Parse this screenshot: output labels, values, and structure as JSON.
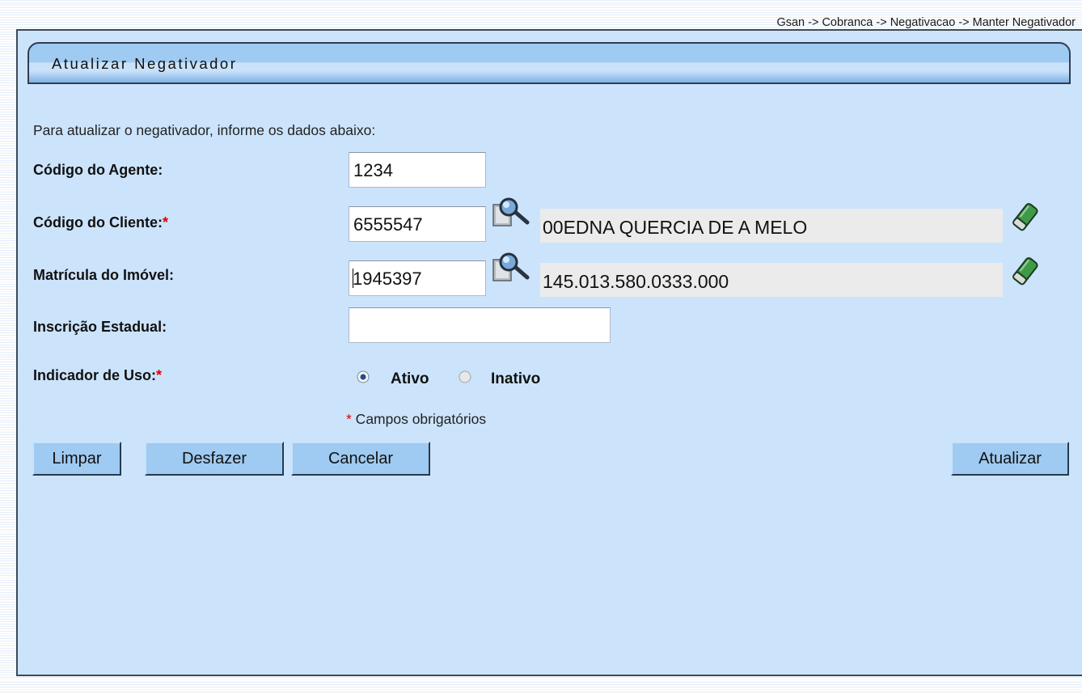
{
  "breadcrumb": "Gsan -> Cobranca -> Negativacao -> Manter Negativador",
  "title": "Atualizar Negativador",
  "intro": "Para atualizar o negativador, informe os dados abaixo:",
  "fields": {
    "agente": {
      "label": "Código do Agente:",
      "value": "1234"
    },
    "cliente": {
      "label": "Código do Cliente:",
      "required": "*",
      "value": "6555547",
      "description": "00EDNA QUERCIA DE A MELO"
    },
    "imovel": {
      "label": "Matrícula do Imóvel:",
      "value": "1945397",
      "description": "145.013.580.0333.000"
    },
    "inscricao": {
      "label": "Inscrição Estadual:",
      "value": ""
    },
    "uso": {
      "label": "Indicador de Uso:",
      "required": "*",
      "options": [
        "Ativo",
        "Inativo"
      ],
      "selected": "Ativo"
    }
  },
  "required_note": {
    "mark": "*",
    "text": " Campos obrigatórios"
  },
  "buttons": {
    "limpar": "Limpar",
    "desfazer": "Desfazer",
    "cancelar": "Cancelar",
    "atualizar": "Atualizar"
  },
  "icons": {
    "search": "magnifier-icon",
    "clear": "eraser-icon"
  },
  "colors": {
    "panel": "#cce4fb",
    "title_bar": "#9fcaf1",
    "required": "#e00000",
    "button": "#9fcaf1"
  }
}
